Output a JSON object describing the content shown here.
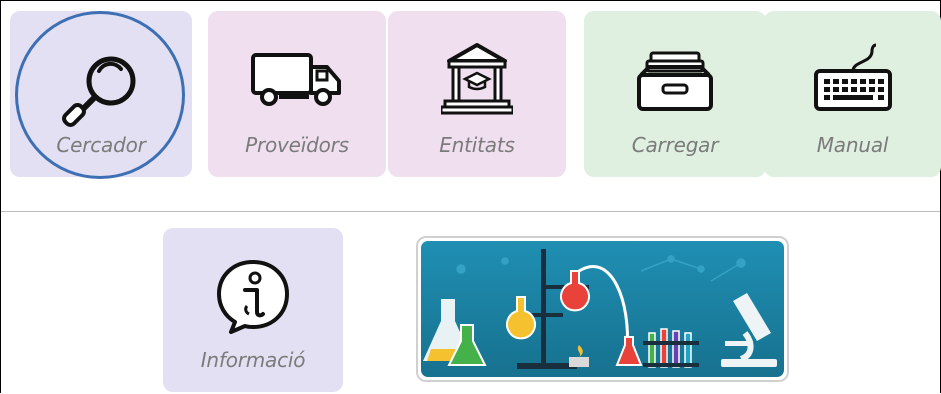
{
  "tiles": {
    "cercador": {
      "label": "Cercador",
      "icon": "magnifier-icon",
      "color": "#e2e0f2"
    },
    "proveidors": {
      "label": "Proveïdors",
      "icon": "truck-icon",
      "color": "#efdfef"
    },
    "entitats": {
      "label": "Entitats",
      "icon": "institution-icon",
      "color": "#efdfef"
    },
    "carregar": {
      "label": "Carregar",
      "icon": "inbox-tray-icon",
      "color": "#dfefe0"
    },
    "manual": {
      "label": "Manual",
      "icon": "keyboard-icon",
      "color": "#dfefe0"
    },
    "informacio": {
      "label": "Informació",
      "icon": "info-bubble-icon",
      "color": "#e2e0f2"
    }
  },
  "banner": {
    "icon": "laboratory-illustration"
  },
  "highlight": {
    "target": "cercador",
    "color": "#3d6fb4"
  }
}
